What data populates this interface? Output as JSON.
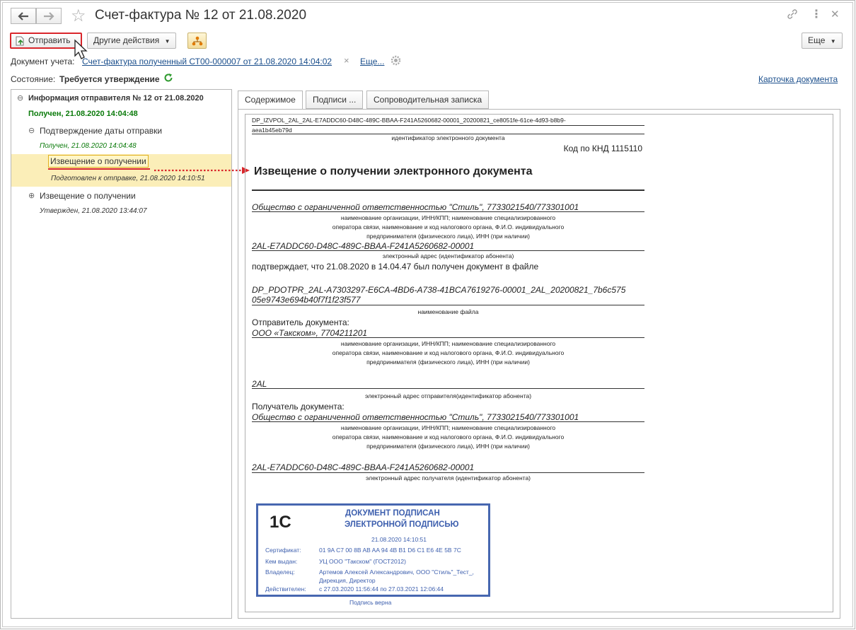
{
  "window": {
    "title": "Счет-фактура № 12 от 21.08.2020"
  },
  "toolbar": {
    "send_label": "Отправить",
    "other_actions_label": "Другие действия",
    "more_label": "Еще"
  },
  "account_doc": {
    "label": "Документ учета:",
    "link": "Счет-фактура полученный СТ00-000007 от 21.08.2020 14:04:02",
    "more_link": "Еще..."
  },
  "state": {
    "label": "Состояние:",
    "value": "Требуется утверждение",
    "card_link": "Карточка документа"
  },
  "tree": {
    "root_title": "Информация отправителя № 12 от 21.08.2020",
    "root_status": "Получен, 21.08.2020 14:04:48",
    "child1_title": "Подтверждение даты отправки",
    "child1_status": "Получен, 21.08.2020 14:04:48",
    "selected_title": "Извещение о получении",
    "selected_status": "Подготовлен к отправке, 21.08.2020 14:10:51",
    "child2_title": "Извещение о получении",
    "child2_status": "Утвержден, 21.08.2020 13:44:07"
  },
  "tabs": {
    "content": "Содержимое",
    "signatures": "Подписи ...",
    "cover_note": "Сопроводительная записка"
  },
  "doc": {
    "id_line1": "DP_IZVPOL_2AL_2AL-E7ADDC60-D48C-489C-BBAA-F241A5260682-00001_20200821_ce8051fe-61ce-4d93-b8b9-",
    "id_line2": "aea1b45eb79d",
    "id_caption": "идентификатор электронного документа",
    "knd": "Код по КНД 1115110",
    "heading": "Извещение о получении электронного документа",
    "org1": "Общество с ограниченной ответственностью \"Стиль\", 7733021540/773301001",
    "org_caption_1": "наименование организации, ИНН/КПП; наименование специализированного",
    "org_caption_2": "оператора связи, наименование и код налогового органа, Ф.И.О. индивидуального",
    "org_caption_3": "предпринимателя (физического лица), ИНН (при наличии)",
    "addr1": "2AL-E7ADDC60-D48C-489C-BBAA-F241A5260682-00001",
    "addr_caption": "электронный адрес (идентификатор абонента)",
    "confirm_text": "подтверждает, что 21.08.2020 в 14.04.47 был получен документ в файле",
    "file_line1": "DP_PDOTPR_2AL-A7303297-E6CA-4BD6-A738-41BCA7619276-00001_2AL_20200821_7b6c575",
    "file_line2": "05e9743e694b40f7f1f23f577",
    "file_caption": "наименование файла",
    "sender_label": "Отправитель документа:",
    "sender_value": "ООО «Такском», 7704211201",
    "sender_addr": "2AL",
    "sender_addr_caption": "электронный адрес отправителя(идентификатор абонента)",
    "recipient_label": "Получатель документа:",
    "recipient_value": "Общество с ограниченной ответственностью \"Стиль\", 7733021540/773301001",
    "recipient_addr": "2AL-E7ADDC60-D48C-489C-BBAA-F241A5260682-00001",
    "recipient_addr_caption": "электронный адрес получателя (идентификатор абонента)"
  },
  "stamp": {
    "logo_text": "1С",
    "title1": "ДОКУМЕНТ ПОДПИСАН",
    "title2": "ЭЛЕКТРОННОЙ ПОДПИСЬЮ",
    "date": "21.08.2020 14:10:51",
    "cert_label": "Сертификат:",
    "cert_value": "01 9A C7 00 8B AB AA 94 4B B1 D6 C1 E6 4E 5B 7C",
    "issuer_label": "Кем выдан:",
    "issuer_value": "УЦ ООО \"Такском\" (ГОСТ2012)",
    "owner_label": "Владелец:",
    "owner_value1": "Артемов Алексей Александрович, ООО \"Стиль\"_Тест_,",
    "owner_value2": "Дирекция, Директор",
    "valid_label": "Действителен:",
    "valid_value": "с 27.03.2020 11:56:44 по 27.03.2021 12:06:44",
    "verified": "Подпись верна"
  },
  "colors": {
    "link": "#1b4f8c",
    "status_green": "#0a7a0a",
    "selected_bg": "#fbeeb8",
    "highlight_red": "#d9262b",
    "stamp_blue": "#4767b0"
  }
}
